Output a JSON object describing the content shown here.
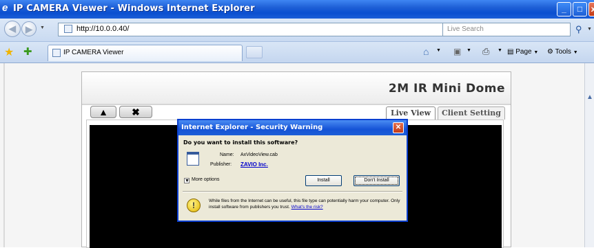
{
  "window": {
    "title": "IP CAMERA Viewer - Windows Internet Explorer",
    "controls": {
      "minimize": "_",
      "maximize": "□",
      "close": "x"
    }
  },
  "addressbar": {
    "url": "http://10.0.0.40/",
    "search_placeholder": "Live Search"
  },
  "tabs": {
    "active_label": "IP CAMERA Viewer"
  },
  "commandbar": {
    "page_label": "Page",
    "tools_label": "Tools"
  },
  "page": {
    "device_title": "2M IR Mini Dome",
    "tabs": [
      "Live View",
      "Client Setting"
    ],
    "active_tab": "Live View"
  },
  "dialog": {
    "title": "Internet Explorer - Security Warning",
    "question": "Do you want to install this software?",
    "name_label": "Name:",
    "name_value": "AxVideoView.cab",
    "publisher_label": "Publisher:",
    "publisher_value": "ZAVIO Inc.",
    "more_options": "More options",
    "install_button": "Install",
    "dont_install_button": "Don't Install",
    "warning_text": "While files from the Internet can be useful, this file type can potentially harm your computer. Only install software from publishers you trust.",
    "risk_link": "What's the risk?"
  },
  "colors": {
    "titlebar_blue": "#0a4fd0",
    "video_background": "#000000",
    "link_blue": "#0000cc"
  }
}
